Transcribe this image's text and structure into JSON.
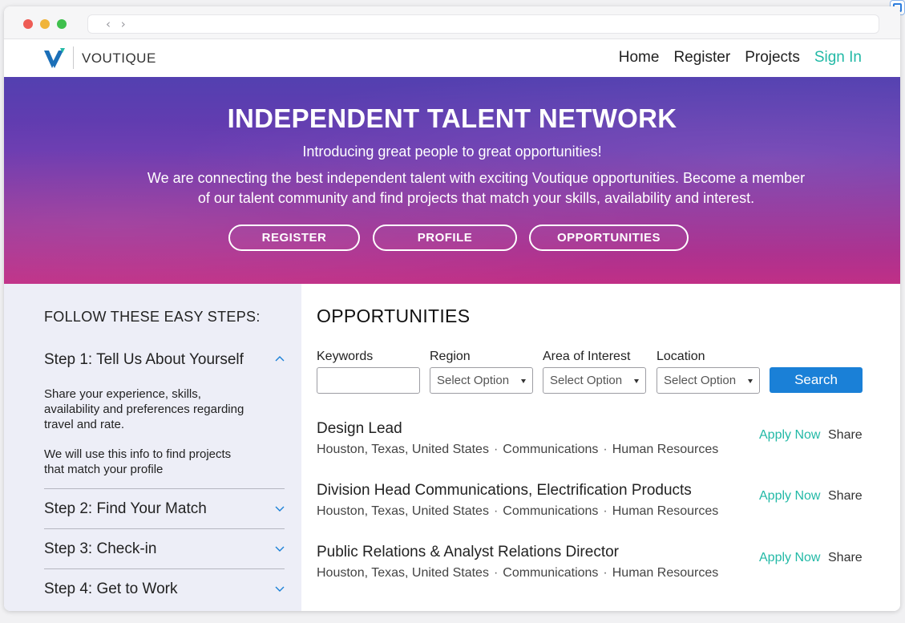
{
  "browser": {
    "nav_arrows": "‹ ›"
  },
  "brand": {
    "name": "VOUTIQUE",
    "colors": {
      "accent": "#22b9a6",
      "primary_button": "#1a80d7",
      "logo_blue": "#1b6fb8"
    }
  },
  "nav": {
    "home": "Home",
    "register": "Register",
    "projects": "Projects",
    "sign_in": "Sign In"
  },
  "hero": {
    "title": "INDEPENDENT TALENT NETWORK",
    "subtitle": "Introducing great people to great opportunities!",
    "description": "We are connecting the best independent talent with exciting Voutique opportunities. Become a member of our talent community and find projects that match your skills, availability and interest.",
    "buttons": {
      "register": "REGISTER",
      "profile": "PROFILE",
      "opportunities": "OPPORTUNITIES"
    }
  },
  "steps": {
    "title": "FOLLOW THESE EASY STEPS:",
    "items": [
      {
        "label": "Step 1: Tell Us About Yourself",
        "expanded": true,
        "body_1": "Share your experience, skills, availability and preferences regarding travel and rate.",
        "body_2": "We will use this info to find projects that match your profile"
      },
      {
        "label": "Step 2: Find Your Match",
        "expanded": false
      },
      {
        "label": "Step 3: Check-in",
        "expanded": false
      },
      {
        "label": "Step 4: Get to Work",
        "expanded": false
      }
    ]
  },
  "opportunities": {
    "title": "OPPORTUNITIES",
    "filters": {
      "keywords_label": "Keywords",
      "keywords_value": "",
      "region_label": "Region",
      "region_value": "Select Option",
      "area_label": "Area of Interest",
      "area_value": "Select Option",
      "location_label": "Location",
      "location_value": "Select Option",
      "search_label": "Search"
    },
    "jobs": [
      {
        "title": "Design Lead",
        "location": "Houston, Texas, United States",
        "category": "Communications",
        "department": "Human Resources",
        "apply": "Apply Now",
        "share": "Share"
      },
      {
        "title": "Division Head Communications, Electrification Products",
        "location": "Houston, Texas, United States",
        "category": "Communications",
        "department": "Human Resources",
        "apply": "Apply Now",
        "share": "Share"
      },
      {
        "title": "Public Relations & Analyst Relations Director",
        "location": "Houston, Texas, United States",
        "category": "Communications",
        "department": "Human Resources",
        "apply": "Apply Now",
        "share": "Share"
      }
    ],
    "meta_separator": "·"
  }
}
